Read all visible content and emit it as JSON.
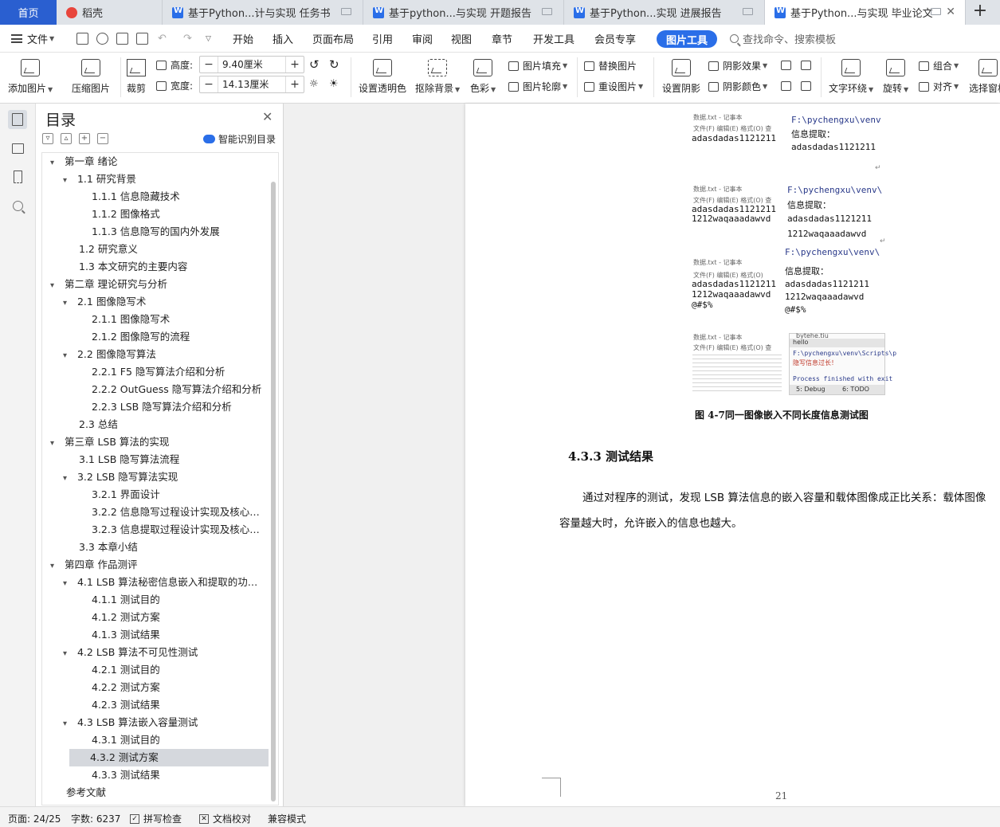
{
  "tabs": {
    "home": "首页",
    "items": [
      {
        "label": "稻壳",
        "icon": "daoke-icon"
      },
      {
        "label": "基于Python...计与实现 任务书",
        "icon": "wps-writer-icon"
      },
      {
        "label": "基于python...与实现 开题报告",
        "icon": "wps-writer-icon"
      },
      {
        "label": "基于Python...实现  进展报告",
        "icon": "wps-writer-icon"
      },
      {
        "label": "基于Python...与实现 毕业论文",
        "icon": "wps-writer-icon",
        "active": true
      }
    ],
    "add": "+"
  },
  "menu": {
    "file": "文件",
    "items": [
      "开始",
      "插入",
      "页面布局",
      "引用",
      "审阅",
      "视图",
      "章节",
      "开发工具",
      "会员专享"
    ],
    "active_tool": "图片工具",
    "search_placeholder": "查找命令、搜索模板"
  },
  "ribbon": {
    "add_picture": "添加图片",
    "compress": "压缩图片",
    "crop": "裁剪",
    "height_label": "高度:",
    "height_value": "9.40厘米",
    "width_label": "宽度:",
    "width_value": "14.13厘米",
    "set_transparent": "设置透明色",
    "remove_bg": "抠除背景",
    "color": "色彩",
    "picture_fill": "图片填充",
    "picture_outline": "图片轮廓",
    "replace_picture": "替换图片",
    "reset_picture": "重设图片",
    "set_shadow": "设置阴影",
    "shadow_effect": "阴影效果",
    "shadow_color": "阴影颜色",
    "text_wrap": "文字环绕",
    "rotate": "旋转",
    "group": "组合",
    "align": "对齐",
    "select_pane": "选择窗格"
  },
  "toc": {
    "title": "目录",
    "ai_label": "智能识别目录",
    "items": [
      {
        "text": "第一章  绪论",
        "level": 0,
        "expanded": true
      },
      {
        "text": "1.1  研究背景",
        "level": 1,
        "expanded": true
      },
      {
        "text": "1.1.1  信息隐藏技术",
        "level": 2
      },
      {
        "text": "1.1.2  图像格式",
        "level": 2
      },
      {
        "text": "1.1.3  信息隐写的国内外发展",
        "level": 2
      },
      {
        "text": "1.2  研究意义",
        "level": 1
      },
      {
        "text": "1.3  本文研究的主要内容",
        "level": 1
      },
      {
        "text": "第二章  理论研究与分析",
        "level": 0,
        "expanded": true
      },
      {
        "text": "2.1  图像隐写术",
        "level": 1,
        "expanded": true
      },
      {
        "text": "2.1.1  图像隐写术",
        "level": 2
      },
      {
        "text": "2.1.2  图像隐写的流程",
        "level": 2
      },
      {
        "text": "2.2 图像隐写算法",
        "level": 1,
        "expanded": true
      },
      {
        "text": "2.2.1 F5 隐写算法介绍和分析",
        "level": 2
      },
      {
        "text": "2.2.2 OutGuess 隐写算法介绍和分析",
        "level": 2
      },
      {
        "text": "2.2.3 LSB 隐写算法介绍和分析",
        "level": 2
      },
      {
        "text": "2.3  总结",
        "level": 1
      },
      {
        "text": "第三章  LSB 算法的实现",
        "level": 0,
        "expanded": true
      },
      {
        "text": "3.1 LSB 隐写算法流程",
        "level": 1
      },
      {
        "text": "3.2 LSB 隐写算法实现",
        "level": 1,
        "expanded": true
      },
      {
        "text": "3.2.1  界面设计",
        "level": 2
      },
      {
        "text": "3.2.2  信息隐写过程设计实现及核心代...",
        "level": 2
      },
      {
        "text": "3.2.3  信息提取过程设计实现及核心代...",
        "level": 2
      },
      {
        "text": "3.3 本章小结",
        "level": 1
      },
      {
        "text": "第四章  作品测评",
        "level": 0,
        "expanded": true
      },
      {
        "text": "4.1 LSB 算法秘密信息嵌入和提取的功能 ...",
        "level": 1,
        "expanded": true
      },
      {
        "text": "4.1.1  测试目的",
        "level": 2
      },
      {
        "text": "4.1.2  测试方案",
        "level": 2
      },
      {
        "text": "4.1.3  测试结果",
        "level": 2
      },
      {
        "text": "4.2 LSB 算法不可见性测试",
        "level": 1,
        "expanded": true
      },
      {
        "text": "4.2.1  测试目的",
        "level": 2
      },
      {
        "text": "4.2.2  测试方案",
        "level": 2
      },
      {
        "text": "4.2.3 测试结果",
        "level": 2
      },
      {
        "text": "4.3 LSB 算法嵌入容量测试",
        "level": 1,
        "expanded": true
      },
      {
        "text": "4.3.1  测试目的",
        "level": 2
      },
      {
        "text": "4.3.2  测试方案",
        "level": 2,
        "selected": true
      },
      {
        "text": "4.3.3  测试结果",
        "level": 2
      },
      {
        "text": "参考文献",
        "level": 0
      }
    ]
  },
  "document": {
    "shot1": {
      "np_title": "数据.txt - 记事本",
      "np_menu": "文件(F)  编辑(E)  格式(O)  查",
      "np_text": "adasdadas1121211",
      "path": "F:\\pychengxu\\venv",
      "label": "信息提取：",
      "out1": "adasdadas1121211"
    },
    "shot2": {
      "np_title": "数据.txt - 记事本",
      "np_menu": "文件(F)  编辑(E)  格式(O)  查",
      "np_text1": "adasdadas1121211",
      "np_text2": "1212waqaaadawvd",
      "path": "F:\\pychengxu\\venv\\",
      "label": "信息提取：",
      "out1": "adasdadas1121211",
      "out2": "1212waqaaadawvd"
    },
    "shot3": {
      "np_title": "数据.txt - 记事本",
      "np_menu": "文件(F)  编辑(E)  格式(O)",
      "np_text1": "adasdadas1121211",
      "np_text2": "1212waqaaadawvd",
      "np_text3": "@#$%",
      "path": "F:\\pychengxu\\venv\\",
      "label": "信息提取：",
      "out1": "adasdadas1121211",
      "out2": "1212waqaaadawvd",
      "out3": "@#$%"
    },
    "shot4": {
      "np_title": "数据.txt - 记事本",
      "np_menu": "文件(F)  编辑(E)  格式(O)  查",
      "file": "bytehe.tiu",
      "hello": "hello",
      "path": "F:\\pychengxu\\venv\\Scripts\\p",
      "msg": "隐写信息过长！",
      "finished": "Process finished with exit",
      "debug": "5: Debug",
      "todo": "6: TODO"
    },
    "caption": "图 4-7同一图像嵌入不同长度信息测试图",
    "heading": "4.3.3  测试结果",
    "para_line1": "通过对程序的测试，发现 LSB 算法信息的嵌入容量和载体图像成正比关系：载体图像",
    "para_line2": "容量越大时，允许嵌入的信息也越大。",
    "page_number": "21"
  },
  "status": {
    "page": "页面: 24/25",
    "words": "字数: 6237",
    "spell": "拼写检查",
    "proof": "文档校对",
    "compat": "兼容模式"
  }
}
